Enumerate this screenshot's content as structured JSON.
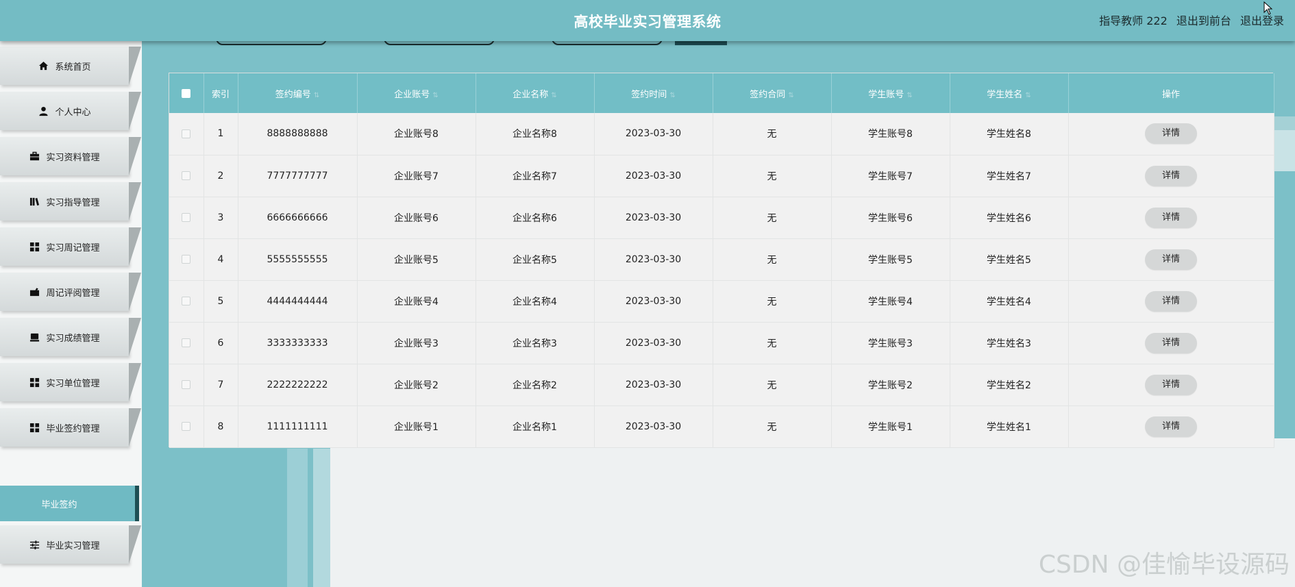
{
  "header": {
    "title": "高校毕业实习管理系统",
    "user_name": "指导教师 222",
    "back_to_front": "退出到前台",
    "logout": "退出登录"
  },
  "sidebar": {
    "items": [
      {
        "label": "系统首页",
        "icon": "home-icon"
      },
      {
        "label": "个人中心",
        "icon": "user-icon"
      },
      {
        "label": "实习资料管理",
        "icon": "briefcase-icon"
      },
      {
        "label": "实习指导管理",
        "icon": "book-icon"
      },
      {
        "label": "实习周记管理",
        "icon": "grid-icon"
      },
      {
        "label": "周记评阅管理",
        "icon": "suitcase-icon"
      },
      {
        "label": "实习成绩管理",
        "icon": "inbox-icon"
      },
      {
        "label": "实习单位管理",
        "icon": "grid-icon"
      },
      {
        "label": "毕业签约管理",
        "icon": "grid-icon"
      },
      {
        "label": "毕业实习管理",
        "icon": "sliders-icon"
      }
    ],
    "active_sub": "毕业签约"
  },
  "table": {
    "headers": {
      "index": "索引",
      "sign_no": "签约编号",
      "company_account": "企业账号",
      "company_name": "企业名称",
      "sign_time": "签约时间",
      "contract": "签约合同",
      "student_account": "学生账号",
      "student_name": "学生姓名",
      "action": "操作"
    },
    "detail_label": "详情",
    "rows": [
      {
        "index": "1",
        "sign_no": "8888888888",
        "company_account": "企业账号8",
        "company_name": "企业名称8",
        "sign_time": "2023-03-30",
        "contract": "无",
        "student_account": "学生账号8",
        "student_name": "学生姓名8"
      },
      {
        "index": "2",
        "sign_no": "7777777777",
        "company_account": "企业账号7",
        "company_name": "企业名称7",
        "sign_time": "2023-03-30",
        "contract": "无",
        "student_account": "学生账号7",
        "student_name": "学生姓名7"
      },
      {
        "index": "3",
        "sign_no": "6666666666",
        "company_account": "企业账号6",
        "company_name": "企业名称6",
        "sign_time": "2023-03-30",
        "contract": "无",
        "student_account": "学生账号6",
        "student_name": "学生姓名6"
      },
      {
        "index": "4",
        "sign_no": "5555555555",
        "company_account": "企业账号5",
        "company_name": "企业名称5",
        "sign_time": "2023-03-30",
        "contract": "无",
        "student_account": "学生账号5",
        "student_name": "学生姓名5"
      },
      {
        "index": "5",
        "sign_no": "4444444444",
        "company_account": "企业账号4",
        "company_name": "企业名称4",
        "sign_time": "2023-03-30",
        "contract": "无",
        "student_account": "学生账号4",
        "student_name": "学生姓名4"
      },
      {
        "index": "6",
        "sign_no": "3333333333",
        "company_account": "企业账号3",
        "company_name": "企业名称3",
        "sign_time": "2023-03-30",
        "contract": "无",
        "student_account": "学生账号3",
        "student_name": "学生姓名3"
      },
      {
        "index": "7",
        "sign_no": "2222222222",
        "company_account": "企业账号2",
        "company_name": "企业名称2",
        "sign_time": "2023-03-30",
        "contract": "无",
        "student_account": "学生账号2",
        "student_name": "学生姓名2"
      },
      {
        "index": "8",
        "sign_no": "1111111111",
        "company_account": "企业账号1",
        "company_name": "企业名称1",
        "sign_time": "2023-03-30",
        "contract": "无",
        "student_account": "学生账号1",
        "student_name": "学生姓名1"
      }
    ]
  },
  "watermark": "CSDN @佳愉毕设源码",
  "colors": {
    "header_bg": "#74bcc4",
    "table_header_bg": "#72bec6",
    "active_menu_bg": "#6fbac3",
    "main_bg": "#7cc0c8"
  }
}
